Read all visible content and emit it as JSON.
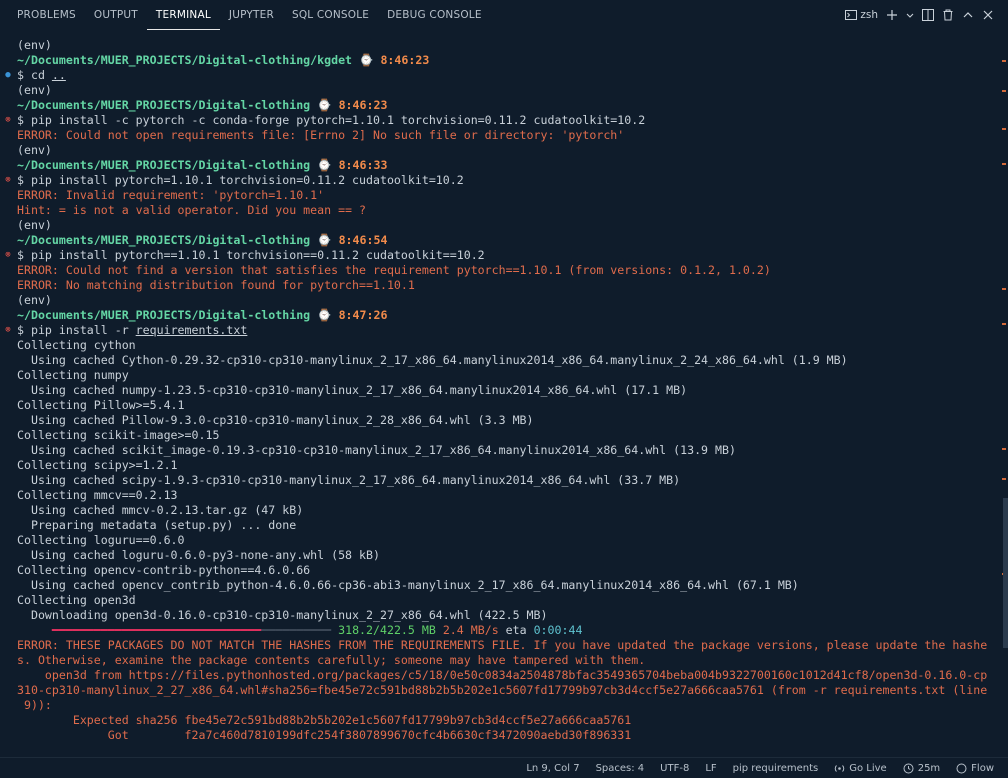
{
  "tabs": [
    {
      "label": "PROBLEMS"
    },
    {
      "label": "OUTPUT"
    },
    {
      "label": "TERMINAL"
    },
    {
      "label": "JUPYTER"
    },
    {
      "label": "SQL CONSOLE"
    },
    {
      "label": "DEBUG CONSOLE"
    }
  ],
  "terminal_shell": "zsh",
  "lines": [
    {
      "gut": "",
      "segs": [
        [
          "(env)",
          ""
        ]
      ]
    },
    {
      "gut": "",
      "segs": [
        [
          "~/Documents/MUER_PROJECTS/Digital-clothing/kgdet",
          "path"
        ],
        [
          " ⌚ ",
          "clock"
        ],
        [
          "8:46:23",
          "time"
        ]
      ]
    },
    {
      "gut": "ok",
      "segs": [
        [
          "$ cd ",
          ""
        ],
        [
          "..",
          "ul"
        ]
      ]
    },
    {
      "gut": "",
      "segs": [
        [
          "(env)",
          ""
        ]
      ]
    },
    {
      "gut": "",
      "segs": [
        [
          "~/Documents/MUER_PROJECTS/Digital-clothing",
          "path"
        ],
        [
          " ⌚ ",
          "clock"
        ],
        [
          "8:46:23",
          "time"
        ]
      ]
    },
    {
      "gut": "err",
      "segs": [
        [
          "$ pip install -c pytorch -c conda-forge pytorch=1.10.1 torchvision=0.11.2 cudatoolkit=10.2",
          ""
        ]
      ]
    },
    {
      "gut": "",
      "segs": [
        [
          "ERROR: Could not open requirements file: [Errno 2] No such file or directory: 'pytorch'",
          "err"
        ]
      ]
    },
    {
      "gut": "",
      "segs": [
        [
          "(env)",
          ""
        ]
      ]
    },
    {
      "gut": "",
      "segs": [
        [
          "~/Documents/MUER_PROJECTS/Digital-clothing",
          "path"
        ],
        [
          " ⌚ ",
          "clock"
        ],
        [
          "8:46:33",
          "time"
        ]
      ]
    },
    {
      "gut": "err",
      "segs": [
        [
          "$ pip install pytorch=1.10.1 torchvision=0.11.2 cudatoolkit=10.2",
          ""
        ]
      ]
    },
    {
      "gut": "",
      "segs": [
        [
          "ERROR: Invalid requirement: 'pytorch=1.10.1'",
          "err"
        ]
      ]
    },
    {
      "gut": "",
      "segs": [
        [
          "Hint: = is not a valid operator. Did you mean == ?",
          "err"
        ]
      ]
    },
    {
      "gut": "",
      "segs": [
        [
          "(env)",
          ""
        ]
      ]
    },
    {
      "gut": "",
      "segs": [
        [
          "~/Documents/MUER_PROJECTS/Digital-clothing",
          "path"
        ],
        [
          " ⌚ ",
          "clock"
        ],
        [
          "8:46:54",
          "time"
        ]
      ]
    },
    {
      "gut": "err",
      "segs": [
        [
          "$ pip install pytorch==1.10.1 torchvision==0.11.2 cudatoolkit==10.2",
          ""
        ]
      ]
    },
    {
      "gut": "",
      "segs": [
        [
          "ERROR: Could not find a version that satisfies the requirement pytorch==1.10.1 (from versions: 0.1.2, 1.0.2)",
          "err"
        ]
      ]
    },
    {
      "gut": "",
      "segs": [
        [
          "ERROR: No matching distribution found for pytorch==1.10.1",
          "err"
        ]
      ]
    },
    {
      "gut": "",
      "segs": [
        [
          "(env)",
          ""
        ]
      ]
    },
    {
      "gut": "",
      "segs": [
        [
          "~/Documents/MUER_PROJECTS/Digital-clothing",
          "path"
        ],
        [
          " ⌚ ",
          "clock"
        ],
        [
          "8:47:26",
          "time"
        ]
      ]
    },
    {
      "gut": "err",
      "segs": [
        [
          "$ pip install -r ",
          ""
        ],
        [
          "requirements.txt",
          "ul"
        ]
      ]
    },
    {
      "gut": "",
      "segs": [
        [
          "Collecting cython",
          ""
        ]
      ]
    },
    {
      "gut": "",
      "segs": [
        [
          "  Using cached Cython-0.29.32-cp310-cp310-manylinux_2_17_x86_64.manylinux2014_x86_64.manylinux_2_24_x86_64.whl (1.9 MB)",
          ""
        ]
      ]
    },
    {
      "gut": "",
      "segs": [
        [
          "Collecting numpy",
          ""
        ]
      ]
    },
    {
      "gut": "",
      "segs": [
        [
          "  Using cached numpy-1.23.5-cp310-cp310-manylinux_2_17_x86_64.manylinux2014_x86_64.whl (17.1 MB)",
          ""
        ]
      ]
    },
    {
      "gut": "",
      "segs": [
        [
          "Collecting Pillow>=5.4.1",
          ""
        ]
      ]
    },
    {
      "gut": "",
      "segs": [
        [
          "  Using cached Pillow-9.3.0-cp310-cp310-manylinux_2_28_x86_64.whl (3.3 MB)",
          ""
        ]
      ]
    },
    {
      "gut": "",
      "segs": [
        [
          "Collecting scikit-image>=0.15",
          ""
        ]
      ]
    },
    {
      "gut": "",
      "segs": [
        [
          "  Using cached scikit_image-0.19.3-cp310-cp310-manylinux_2_17_x86_64.manylinux2014_x86_64.whl (13.9 MB)",
          ""
        ]
      ]
    },
    {
      "gut": "",
      "segs": [
        [
          "Collecting scipy>=1.2.1",
          ""
        ]
      ]
    },
    {
      "gut": "",
      "segs": [
        [
          "  Using cached scipy-1.9.3-cp310-cp310-manylinux_2_17_x86_64.manylinux2014_x86_64.whl (33.7 MB)",
          ""
        ]
      ]
    },
    {
      "gut": "",
      "segs": [
        [
          "Collecting mmcv==0.2.13",
          ""
        ]
      ]
    },
    {
      "gut": "",
      "segs": [
        [
          "  Using cached mmcv-0.2.13.tar.gz (47 kB)",
          ""
        ]
      ]
    },
    {
      "gut": "",
      "segs": [
        [
          "  Preparing metadata (setup.py) ... done",
          ""
        ]
      ]
    },
    {
      "gut": "",
      "segs": [
        [
          "Collecting loguru==0.6.0",
          ""
        ]
      ]
    },
    {
      "gut": "",
      "segs": [
        [
          "  Using cached loguru-0.6.0-py3-none-any.whl (58 kB)",
          ""
        ]
      ]
    },
    {
      "gut": "",
      "segs": [
        [
          "Collecting opencv-contrib-python==4.6.0.66",
          ""
        ]
      ]
    },
    {
      "gut": "",
      "segs": [
        [
          "  Using cached opencv_contrib_python-4.6.0.66-cp36-abi3-manylinux_2_17_x86_64.manylinux2014_x86_64.whl (67.1 MB)",
          ""
        ]
      ]
    },
    {
      "gut": "",
      "segs": [
        [
          "Collecting open3d",
          ""
        ]
      ]
    },
    {
      "gut": "",
      "segs": [
        [
          "  Downloading open3d-0.16.0-cp310-cp310-manylinux_2_27_x86_64.whl (422.5 MB)",
          ""
        ]
      ]
    },
    {
      "gut": "",
      "segs": [
        [
          "     ",
          ""
        ],
        [
          "━━━━━━━━━━━━━━━━━━━━━━━━━━━━━━",
          "prog-done"
        ],
        [
          "━━━━━━━━━━",
          "prog-rest"
        ],
        [
          " ",
          ""
        ],
        [
          "318.2/422.5 MB",
          "green"
        ],
        [
          " ",
          ""
        ],
        [
          "2.4 MB/s",
          "err"
        ],
        [
          " eta ",
          ""
        ],
        [
          "0:00:44",
          "cyan"
        ]
      ]
    },
    {
      "gut": "",
      "segs": [
        [
          "ERROR: THESE PACKAGES DO NOT MATCH THE HASHES FROM THE REQUIREMENTS FILE. If you have updated the package versions, please update the hashe",
          "err"
        ]
      ]
    },
    {
      "gut": "",
      "segs": [
        [
          "s. Otherwise, examine the package contents carefully; someone may have tampered with them.",
          "err"
        ]
      ]
    },
    {
      "gut": "",
      "segs": [
        [
          "    open3d from https://files.pythonhosted.org/packages/c5/18/0e50c0834a2504878bfac3549365704beba004b9322700160c1012d41cf8/open3d-0.16.0-cp",
          "err"
        ]
      ]
    },
    {
      "gut": "",
      "segs": [
        [
          "310-cp310-manylinux_2_27_x86_64.whl#sha256=fbe45e72c591bd88b2b5b202e1c5607fd17799b97cb3d4ccf5e27a666caa5761 (from -r requirements.txt (line",
          "err"
        ]
      ]
    },
    {
      "gut": "",
      "segs": [
        [
          " 9)):",
          "err"
        ]
      ]
    },
    {
      "gut": "",
      "segs": [
        [
          "        Expected sha256 fbe45e72c591bd88b2b5b202e1c5607fd17799b97cb3d4ccf5e27a666caa5761",
          "err"
        ]
      ]
    },
    {
      "gut": "",
      "segs": [
        [
          "             Got        f2a7c460d7810199dfc254f3807899670cfc4b6630cf3472090aebd30f896331",
          "err"
        ]
      ]
    }
  ],
  "status": {
    "position": "Ln 9, Col 7",
    "spaces": "Spaces: 4",
    "encoding": "UTF-8",
    "eol": "LF",
    "language": "pip requirements",
    "golive": "Go Live",
    "timer": "25m",
    "flow": "Flow"
  },
  "colors": {
    "background": "#0f1c2b",
    "path": "#64d6a5",
    "time": "#f28b4b",
    "error": "#e06c4c",
    "progress": "#e0305e"
  }
}
